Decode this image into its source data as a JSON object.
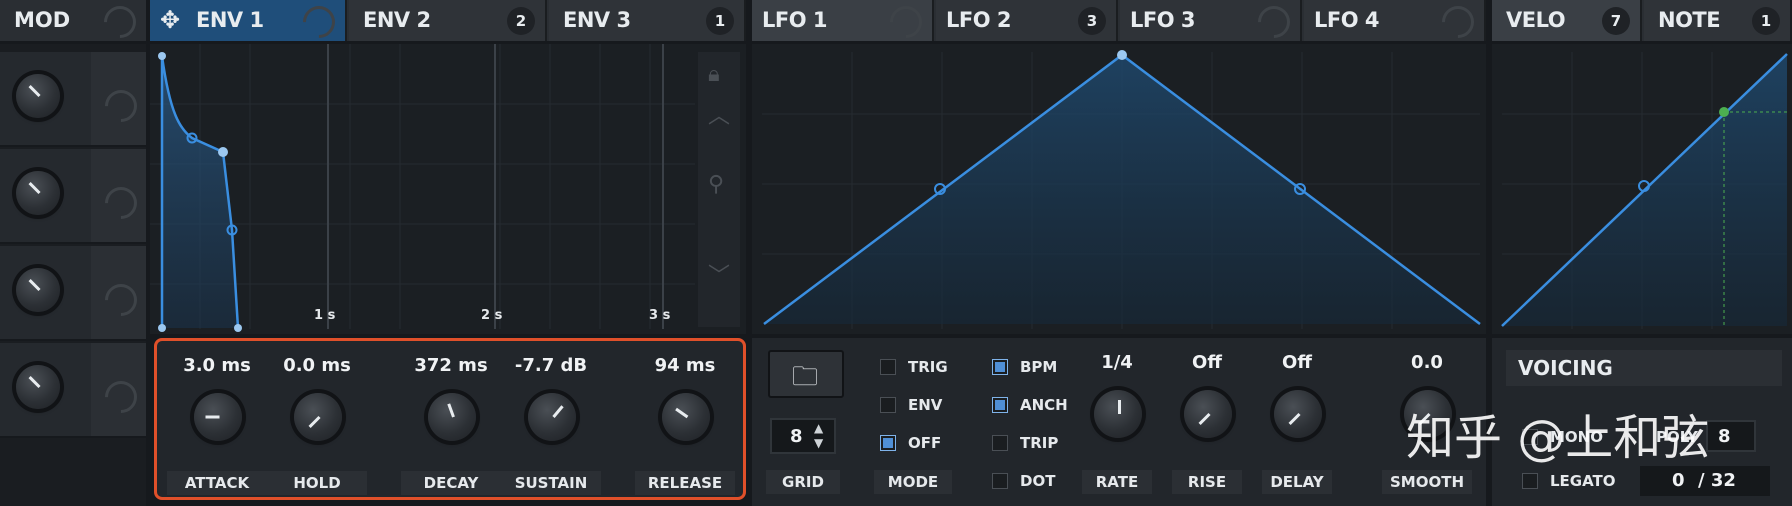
{
  "mod_panel": {
    "title": "MOD"
  },
  "env_tabs": [
    {
      "label": "ENV 1",
      "badge": ""
    },
    {
      "label": "ENV 2",
      "badge": "2"
    },
    {
      "label": "ENV 3",
      "badge": "1"
    }
  ],
  "lfo_tabs": [
    {
      "label": "LFO 1",
      "badge": ""
    },
    {
      "label": "LFO 2",
      "badge": "3"
    },
    {
      "label": "LFO 3",
      "badge": ""
    },
    {
      "label": "LFO 4",
      "badge": ""
    }
  ],
  "velo_tabs": [
    {
      "label": "VELO",
      "badge": "7"
    },
    {
      "label": "NOTE",
      "badge": "1"
    }
  ],
  "env_graph": {
    "time_labels": [
      "1 s",
      "2 s",
      "3 s"
    ]
  },
  "env_knobs": [
    {
      "label": "ATTACK",
      "value": "3.0 ms"
    },
    {
      "label": "HOLD",
      "value": "0.0 ms"
    },
    {
      "label": "DECAY",
      "value": "372 ms"
    },
    {
      "label": "SUSTAIN",
      "value": "-7.7 dB"
    },
    {
      "label": "RELEASE",
      "value": "94 ms"
    }
  ],
  "lfo_controls": {
    "grid_value": "8",
    "grid_label": "GRID",
    "mode_label": "MODE",
    "mode_options": [
      {
        "label": "TRIG",
        "checked": false
      },
      {
        "label": "ENV",
        "checked": false
      },
      {
        "label": "OFF",
        "checked": true
      }
    ],
    "flag_options": [
      {
        "label": "BPM",
        "checked": true
      },
      {
        "label": "ANCH",
        "checked": true
      },
      {
        "label": "TRIP",
        "checked": false
      },
      {
        "label": "DOT",
        "checked": false
      }
    ],
    "knobs": [
      {
        "label": "RATE",
        "value": "1/4"
      },
      {
        "label": "RISE",
        "value": "Off"
      },
      {
        "label": "DELAY",
        "value": "Off"
      },
      {
        "label": "SMOOTH",
        "value": "0.0"
      }
    ]
  },
  "voicing": {
    "title": "VOICING",
    "mono_label": "MONO",
    "poly_label": "POLY",
    "poly_value": "8",
    "legato_label": "LEGATO",
    "voice_count": "0",
    "voice_max": "/ 32"
  },
  "watermark": "知乎 @上和弦",
  "colors": {
    "accent": "#3a8ee0",
    "highlight_border": "#e0502a",
    "active_tab": "#1f4e7a"
  }
}
